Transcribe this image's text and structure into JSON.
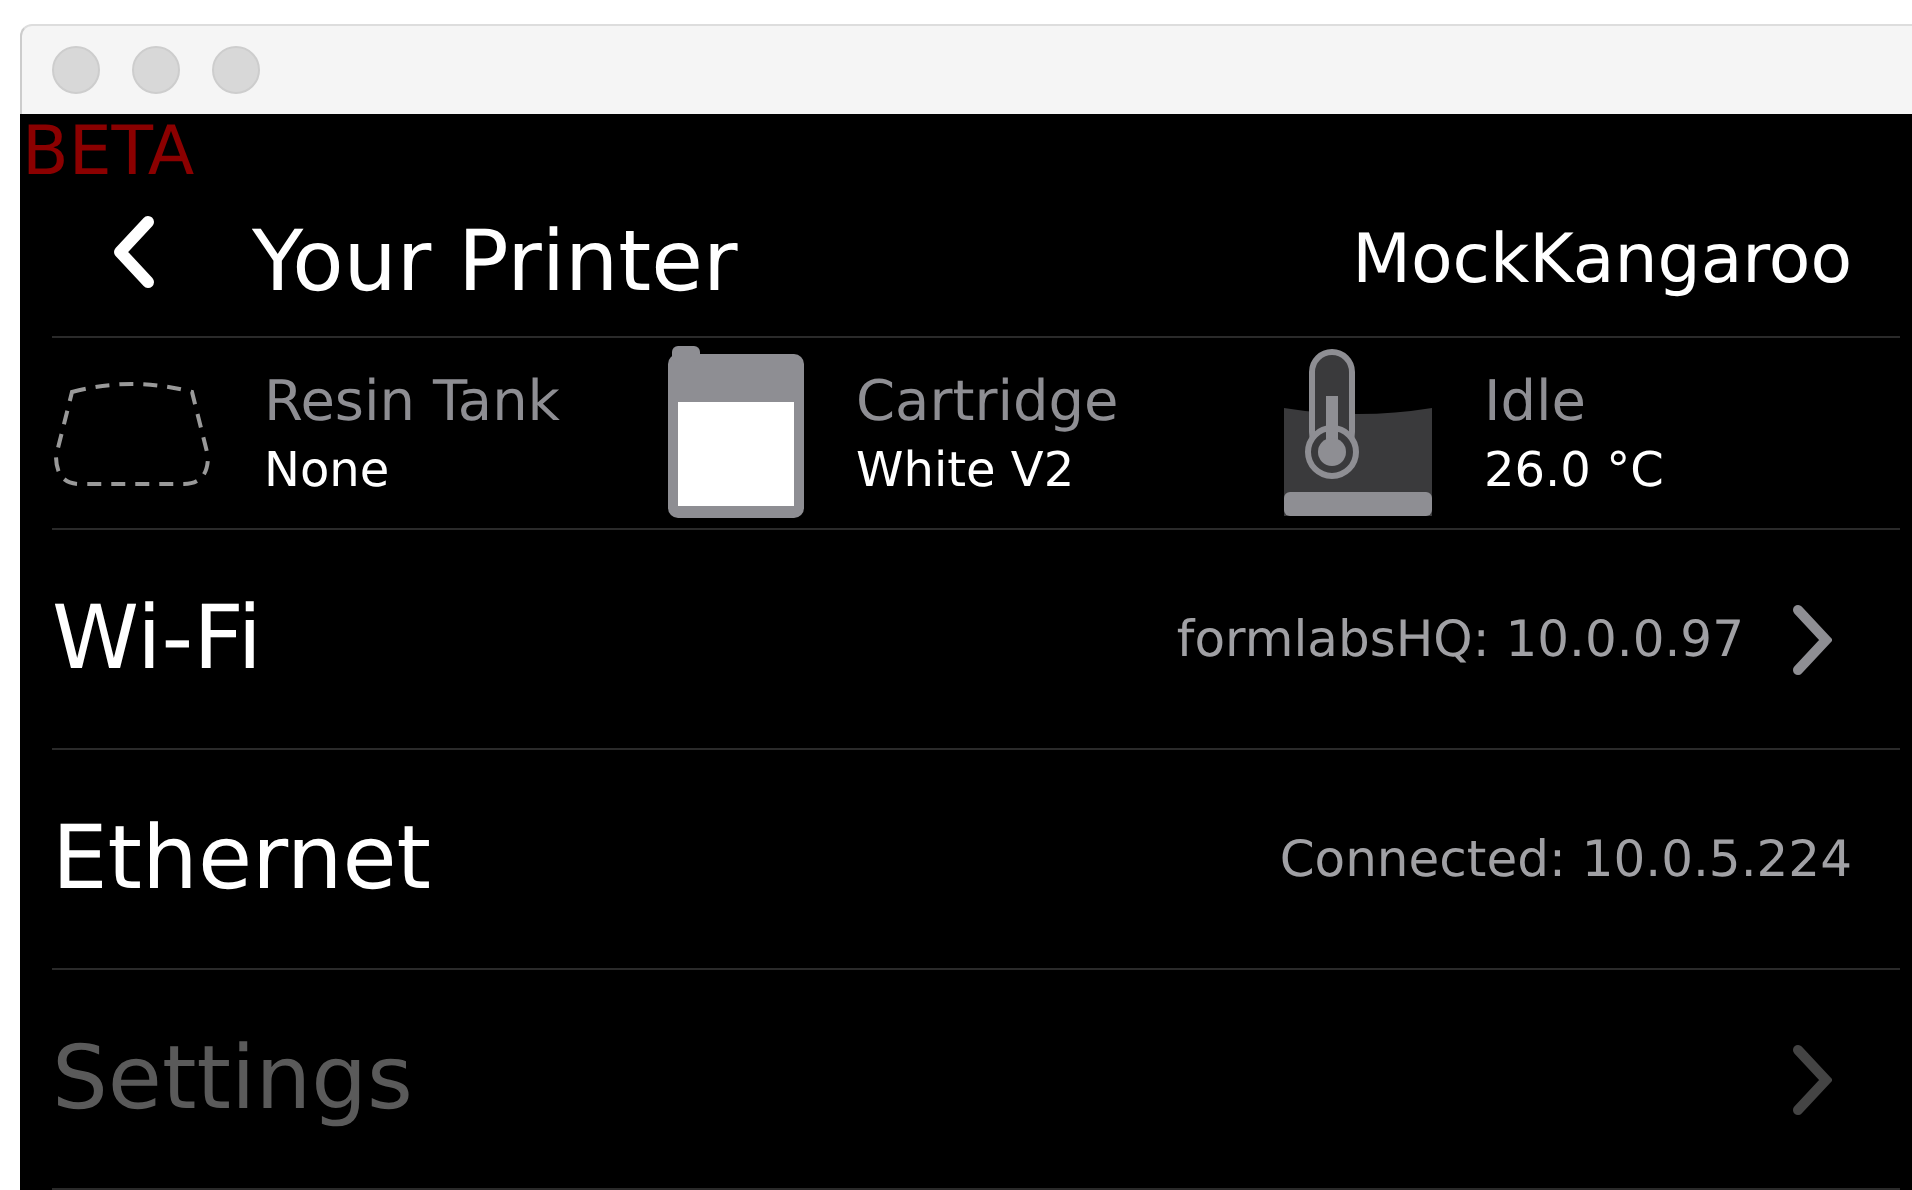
{
  "badge": "BETA",
  "header": {
    "title": "Your Printer",
    "printer_name": "MockKangaroo"
  },
  "status": [
    {
      "kind": "tank",
      "label": "Resin Tank",
      "value": "None"
    },
    {
      "kind": "cartridge",
      "label": "Cartridge",
      "value": "White V2"
    },
    {
      "kind": "temperature",
      "label": "Idle",
      "value": "26.0 °C"
    }
  ],
  "rows": [
    {
      "label": "Wi-Fi",
      "value": "formlabsHQ: 10.0.0.97",
      "chevron": true,
      "dimmed": false
    },
    {
      "label": "Ethernet",
      "value": "Connected: 10.0.5.224",
      "chevron": false,
      "dimmed": false
    },
    {
      "label": "Settings",
      "chevron": true,
      "dimmed": true
    }
  ]
}
